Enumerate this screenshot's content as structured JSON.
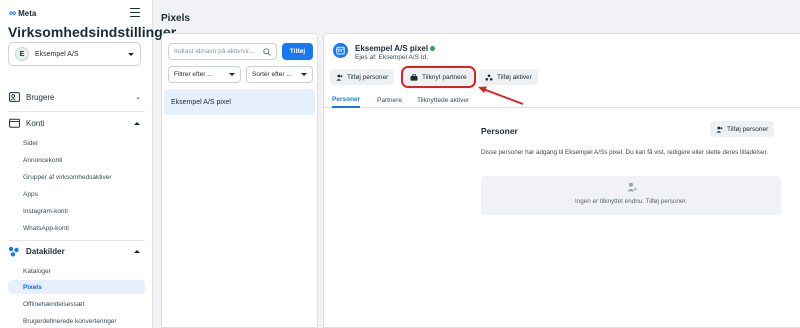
{
  "brand": {
    "name": "Meta"
  },
  "sidebar": {
    "title": "Virksomhedsindstillinger",
    "account": {
      "initial": "E",
      "name": "Eksempel A/S"
    },
    "sections": [
      {
        "label": "Brugere"
      },
      {
        "label": "Konti",
        "items": [
          "Sider",
          "Annoncekonti",
          "Grupper af virksomhedsaktiver",
          "Apps",
          "Instagram-konti",
          "WhatsApp-konti"
        ]
      },
      {
        "label": "Datakilder",
        "items": [
          "Kataloger",
          "Pixels",
          "Offlinehændelsessæt",
          "Brugerdefinerede konverteringer"
        ]
      }
    ]
  },
  "page": {
    "title": "Pixels"
  },
  "list": {
    "search_placeholder": "Indtast id/navn på aktiv/vir...",
    "add_label": "Tilføj",
    "filter_label": "Filtrer efter ...",
    "sort_label": "Sortér efter ...",
    "items": [
      "Eksempel A/S pixel"
    ]
  },
  "detail": {
    "name": "Eksempel A/S pixel",
    "owner": "Ejes af: Eksempel A/S  Id:",
    "actions": {
      "add_people": "Tilføj personer",
      "assign_partners": "Tilknyt partnere",
      "add_assets": "Tilføj aktiver"
    },
    "tabs": [
      "Personer",
      "Partnere",
      "Tilknyttede aktiver"
    ],
    "persons": {
      "title": "Personer",
      "add_label": "Tilføj personer",
      "description": "Disse personer har adgang til Eksempel A/Ss pixel. Du kan få vist, redigere eller slette deres tilladelser.",
      "empty_text": "Ingen er tilknyttet endnu. Tilføj personer."
    }
  },
  "colors": {
    "accent": "#1877f2",
    "highlight": "#e02020",
    "status": "#31a24c"
  }
}
